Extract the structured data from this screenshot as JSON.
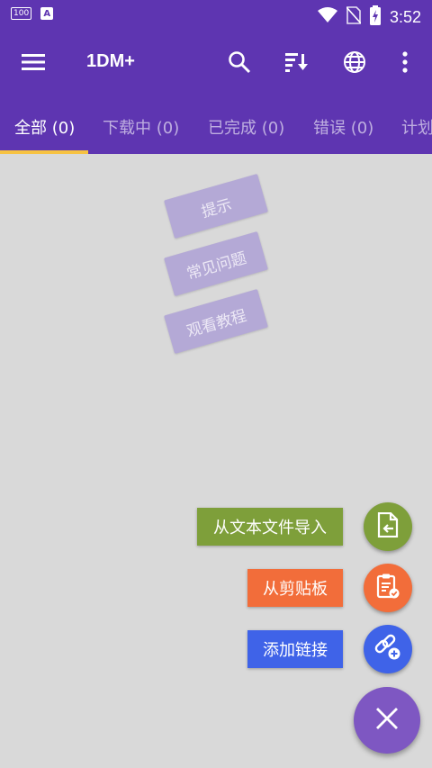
{
  "status_bar": {
    "badge_100": "100",
    "badge_a": "A",
    "time": "3:52",
    "icons": [
      "wifi-icon",
      "no-sim-icon",
      "battery-charging-icon"
    ]
  },
  "app_bar": {
    "title": "1DM+",
    "icons": [
      "menu-icon",
      "search-icon",
      "sort-icon",
      "globe-icon",
      "more-vert-icon"
    ]
  },
  "tabs": [
    {
      "label": "全部 (0)",
      "active": true
    },
    {
      "label": "下载中 (0)",
      "active": false
    },
    {
      "label": "已完成 (0)",
      "active": false
    },
    {
      "label": "错误 (0)",
      "active": false
    },
    {
      "label": "计划",
      "active": false
    }
  ],
  "tips": {
    "hint": "提示",
    "faq": "常见问题",
    "tutorial": "观看教程"
  },
  "fab_menu": {
    "import_from_file": "从文本文件导入",
    "from_clipboard": "从剪贴板",
    "add_link": "添加链接"
  },
  "colors": {
    "primary": "#5e35b1",
    "tab_indicator": "#f6c242",
    "import_green": "#7e9f3a",
    "clipboard_orange": "#f26d3a",
    "link_blue": "#3f63e8",
    "fab_purple": "#7e57c2"
  }
}
